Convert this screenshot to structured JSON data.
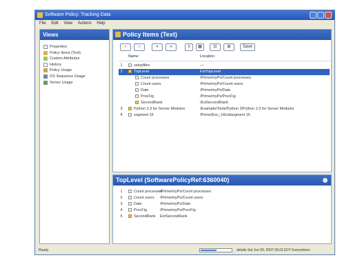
{
  "window": {
    "title": "Software Policy: Tracking Data"
  },
  "menu": [
    "File",
    "Edit",
    "View",
    "Actions",
    "Help"
  ],
  "views": {
    "heading": "Views",
    "items": [
      "Properties",
      "Policy Items (Text)",
      "Custom Attributes",
      "History",
      "Policy Usage",
      "OS Sequence Usage",
      "Server Usage"
    ]
  },
  "policy_items": {
    "heading": "Policy Items (Text)",
    "toolbar": [
      "‹",
      "›",
      "«",
      "»",
      "≡",
      "▦",
      "⊡",
      "⊞",
      "Save"
    ],
    "columns": {
      "name": "Name",
      "location": "Location"
    },
    "rows": [
      {
        "num": "1",
        "name": "setupfiles",
        "location": "—"
      },
      {
        "num": "2",
        "name": "TopLevel",
        "location": "ExtTopLevel"
      },
      {
        "num": "",
        "name": "Count processes",
        "location": "/Prime/myPs/Count processes"
      },
      {
        "num": "",
        "name": "Count users",
        "location": "/Prime/myPs/Count users"
      },
      {
        "num": "",
        "name": "Date",
        "location": "/Prime/myPs/Date"
      },
      {
        "num": "",
        "name": "ProcFig",
        "location": "/Prime/myPs/ProcFig"
      },
      {
        "num": "",
        "name": "SecondRank",
        "location": "/ExtSecondRank"
      },
      {
        "num": "3",
        "name": "Python 2.3 for Server Modules",
        "location": "/Example/Tools/Python 2/Python 2.3 for Server Modules"
      },
      {
        "num": "4",
        "name": "segment 15",
        "location": "/Prime/Exc_1/Endsegment 15"
      }
    ]
  },
  "detail": {
    "heading": "TopLevel (SoftwarePolicyRef:6360040)",
    "rows": [
      {
        "num": "1",
        "name": "Count processes",
        "location": "/Prime/myPs/Count processes"
      },
      {
        "num": "2",
        "name": "Count users",
        "location": "/Prime/myPs/Count users"
      },
      {
        "num": "3",
        "name": "Date",
        "location": "/Prime/myPs/Date"
      },
      {
        "num": "4",
        "name": "ProcFig",
        "location": "/Prime/myPs/ProcFig"
      },
      {
        "num": "5",
        "name": "SecondRank",
        "location": "ExtSecondRank"
      }
    ]
  },
  "status": {
    "left": "Ready",
    "right": "details  Sat Jun 09, 2007 09:23 EDT Everywhere",
    "progress": 0.5
  },
  "colors": {
    "title_bar": "#2a58b0",
    "selection": "#2f63c0",
    "chrome": "#ece9d8"
  }
}
